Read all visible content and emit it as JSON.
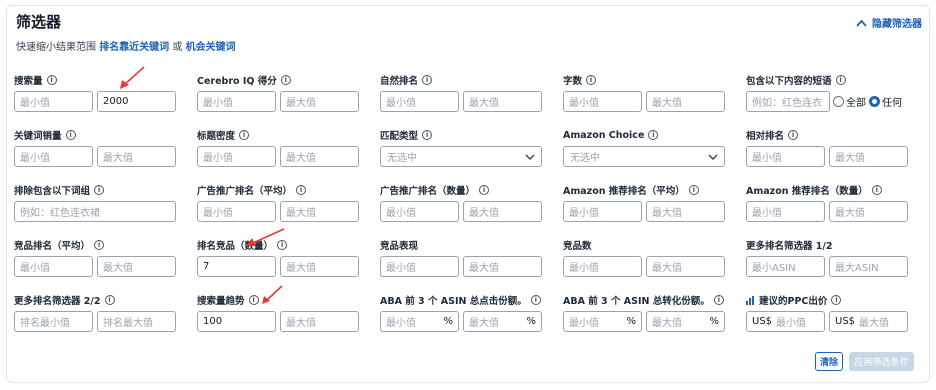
{
  "header": {
    "title": "筛选器",
    "hide_label": "隐藏筛选器",
    "subtitle_prefix": "快速缩小结果范围",
    "link_ranking": "排名靠近关键词",
    "subtitle_or": "或",
    "link_opportunity": "机会关键词"
  },
  "fields": {
    "search_volume": {
      "label": "搜索量",
      "min": "最小值",
      "max": "2000"
    },
    "cerebro_iq": {
      "label": "Cerebro IQ 得分",
      "min": "最小值",
      "max": "最大值"
    },
    "organic_rank": {
      "label": "自然排名",
      "min": "最小值",
      "max": "最大值"
    },
    "word_count": {
      "label": "字数",
      "min": "最小值",
      "max": "最大值"
    },
    "phrases_containing": {
      "label": "包含以下内容的短语",
      "placeholder": "例如：红色连衣",
      "opt_all": "全部",
      "opt_any": "任何"
    },
    "keyword_sales": {
      "label": "关键词销量",
      "min": "最小值",
      "max": "最大值"
    },
    "title_density": {
      "label": "标题密度",
      "min": "最小值",
      "max": "最大值"
    },
    "match_type": {
      "label": "匹配类型",
      "value": "无选中"
    },
    "amazon_choice": {
      "label": "Amazon Choice",
      "value": "无选中"
    },
    "relative_rank": {
      "label": "相对排名",
      "min": "最小值",
      "max": "最大值"
    },
    "exclude_phrases": {
      "label": "排除包含以下词组",
      "placeholder": "例如：红色连衣裙"
    },
    "sponsored_rank_avg": {
      "label": "广告推广排名（平均）",
      "min": "最小值",
      "max": "最大值"
    },
    "sponsored_rank_count": {
      "label": "广告推广排名（数量）",
      "min": "最小值",
      "max": "最大值"
    },
    "amazon_rec_rank_avg": {
      "label": "Amazon 推荐排名（平均）",
      "min": "最小值",
      "max": "最大值"
    },
    "amazon_rec_rank_count": {
      "label": "Amazon 推荐排名（数量）",
      "min": "最小值",
      "max": "最大值"
    },
    "competitor_rank_avg": {
      "label": "竞品排名（平均）",
      "min": "最小值",
      "max": "最大值"
    },
    "ranking_competitors_count": {
      "label": "排名竞品（数量）",
      "min": "7",
      "max": "最大值"
    },
    "competitor_performance": {
      "label": "竞品表现",
      "min": "最小值",
      "max": "最大值"
    },
    "competitor_count": {
      "label": "竞品数",
      "min": "最小值",
      "max": "最大值"
    },
    "more_rank_filters_1": {
      "label": "更多排名筛选器 1/2",
      "min": "最小ASIN",
      "max": "最大ASIN"
    },
    "more_rank_filters_2": {
      "label": "更多排名筛选器 2/2",
      "min": "排名最小值",
      "max": "排名最大值"
    },
    "search_trend": {
      "label": "搜索量趋势",
      "min": "100",
      "max": "最大值"
    },
    "aba_click_share": {
      "label": "ABA 前 3 个 ASIN 总点击份额。",
      "min": "最小值",
      "max": "最大值",
      "unit": "%"
    },
    "aba_conversion_share": {
      "label": "ABA 前 3 个 ASIN 总转化份额。",
      "min": "最小值",
      "max": "最大值",
      "unit": "%"
    },
    "suggested_ppc": {
      "label": "建议的PPC出价",
      "currency": "US$",
      "min": "最小值",
      "max": "最大值"
    }
  },
  "buttons": {
    "clear": "清除",
    "apply": "应用筛选条件"
  },
  "colors": {
    "link": "#1e63b6",
    "annotation_arrow": "#e53935",
    "apply_disabled": "#c9d6e6"
  }
}
